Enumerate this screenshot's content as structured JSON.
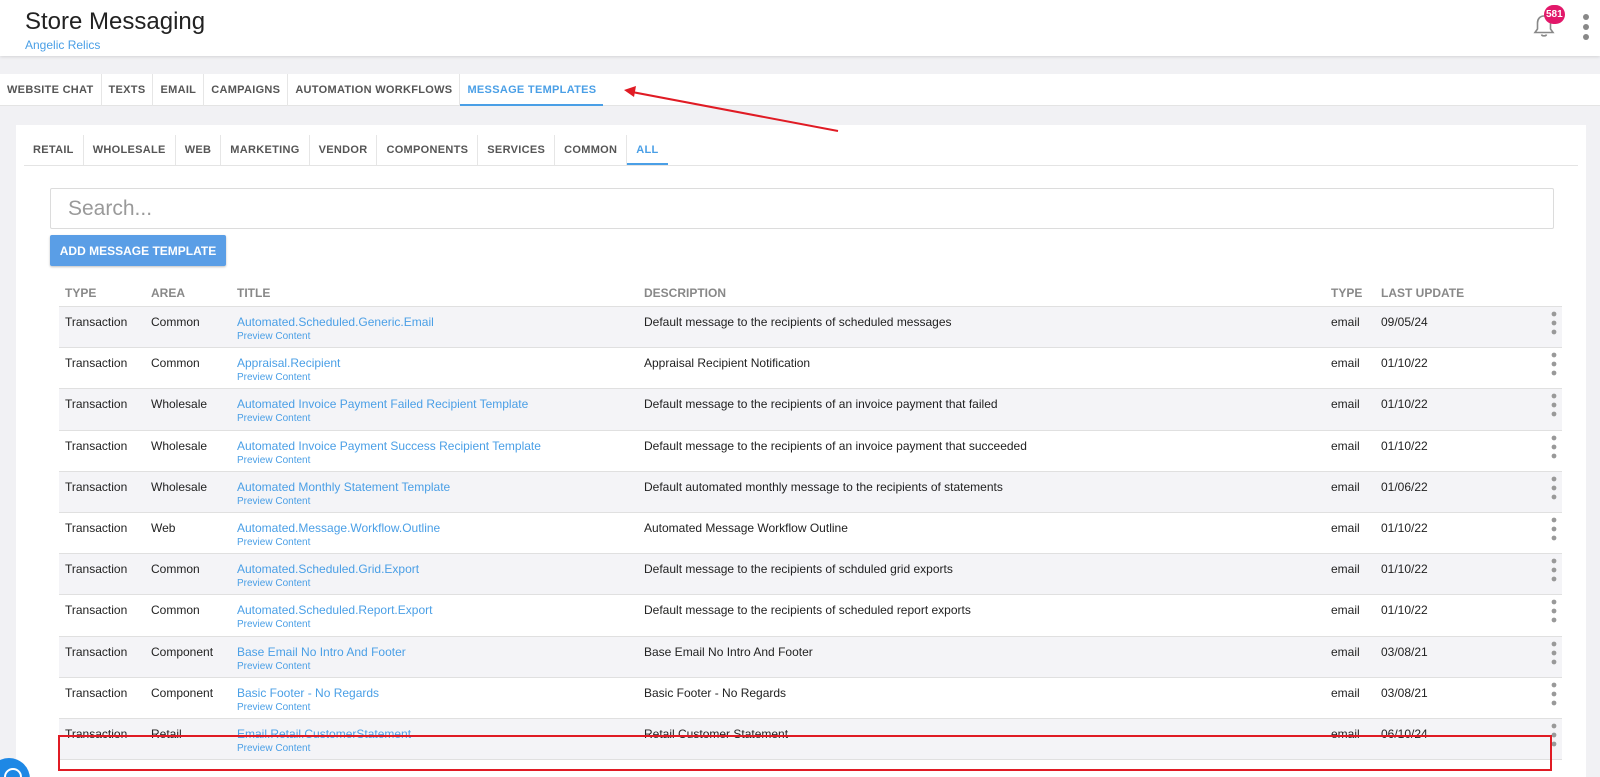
{
  "header": {
    "title": "Store Messaging",
    "subtitle": "Angelic Relics",
    "notification_count": "581"
  },
  "main_tabs": [
    {
      "label": "WEBSITE CHAT"
    },
    {
      "label": "TEXTS"
    },
    {
      "label": "EMAIL"
    },
    {
      "label": "CAMPAIGNS"
    },
    {
      "label": "AUTOMATION WORKFLOWS"
    },
    {
      "label": "MESSAGE TEMPLATES",
      "active": true
    }
  ],
  "sub_tabs": [
    {
      "label": "RETAIL"
    },
    {
      "label": "WHOLESALE"
    },
    {
      "label": "WEB"
    },
    {
      "label": "MARKETING"
    },
    {
      "label": "VENDOR"
    },
    {
      "label": "COMPONENTS"
    },
    {
      "label": "SERVICES"
    },
    {
      "label": "COMMON"
    },
    {
      "label": "ALL",
      "active": true
    }
  ],
  "search": {
    "placeholder": "Search..."
  },
  "add_button_label": "ADD MESSAGE TEMPLATE",
  "table": {
    "columns": {
      "type": "TYPE",
      "area": "AREA",
      "title": "TITLE",
      "description": "DESCRIPTION",
      "type2": "TYPE",
      "last_update": "LAST UPDATE"
    },
    "preview_label": "Preview Content",
    "rows": [
      {
        "type": "Transaction",
        "area": "Common",
        "title": "Automated.Scheduled.Generic.Email",
        "description": "Default message to the recipients of scheduled messages",
        "channel": "email",
        "last_update": "09/05/24"
      },
      {
        "type": "Transaction",
        "area": "Common",
        "title": "Appraisal.Recipient",
        "description": "Appraisal Recipient Notification",
        "channel": "email",
        "last_update": "01/10/22"
      },
      {
        "type": "Transaction",
        "area": "Wholesale",
        "title": "Automated Invoice Payment Failed Recipient Template",
        "description": "Default message to the recipients of an invoice payment that failed",
        "channel": "email",
        "last_update": "01/10/22"
      },
      {
        "type": "Transaction",
        "area": "Wholesale",
        "title": "Automated Invoice Payment Success Recipient Template",
        "description": "Default message to the recipients of an invoice payment that succeeded",
        "channel": "email",
        "last_update": "01/10/22"
      },
      {
        "type": "Transaction",
        "area": "Wholesale",
        "title": "Automated Monthly Statement Template",
        "description": "Default automated monthly message to the recipients of statements",
        "channel": "email",
        "last_update": "01/06/22"
      },
      {
        "type": "Transaction",
        "area": "Web",
        "title": "Automated.Message.Workflow.Outline",
        "description": "Automated Message Workflow Outline",
        "channel": "email",
        "last_update": "01/10/22"
      },
      {
        "type": "Transaction",
        "area": "Common",
        "title": "Automated.Scheduled.Grid.Export",
        "description": "Default message to the recipients of schduled grid exports",
        "channel": "email",
        "last_update": "01/10/22"
      },
      {
        "type": "Transaction",
        "area": "Common",
        "title": "Automated.Scheduled.Report.Export",
        "description": "Default message to the recipients of scheduled report exports",
        "channel": "email",
        "last_update": "01/10/22"
      },
      {
        "type": "Transaction",
        "area": "Component",
        "title": "Base Email No Intro And Footer",
        "description": "Base Email No Intro And Footer",
        "channel": "email",
        "last_update": "03/08/21"
      },
      {
        "type": "Transaction",
        "area": "Component",
        "title": "Basic Footer - No Regards",
        "description": "Basic Footer - No Regards",
        "channel": "email",
        "last_update": "03/08/21"
      },
      {
        "type": "Transaction",
        "area": "Retail",
        "title": "Email.Retail.CustomerStatement",
        "description": "Retail Customer Statement",
        "channel": "email",
        "last_update": "06/10/24"
      }
    ]
  },
  "colors": {
    "accent": "#4a9fe6",
    "button": "#5a9ee6",
    "badge": "#e2186a",
    "annotation": "#e01b24"
  }
}
